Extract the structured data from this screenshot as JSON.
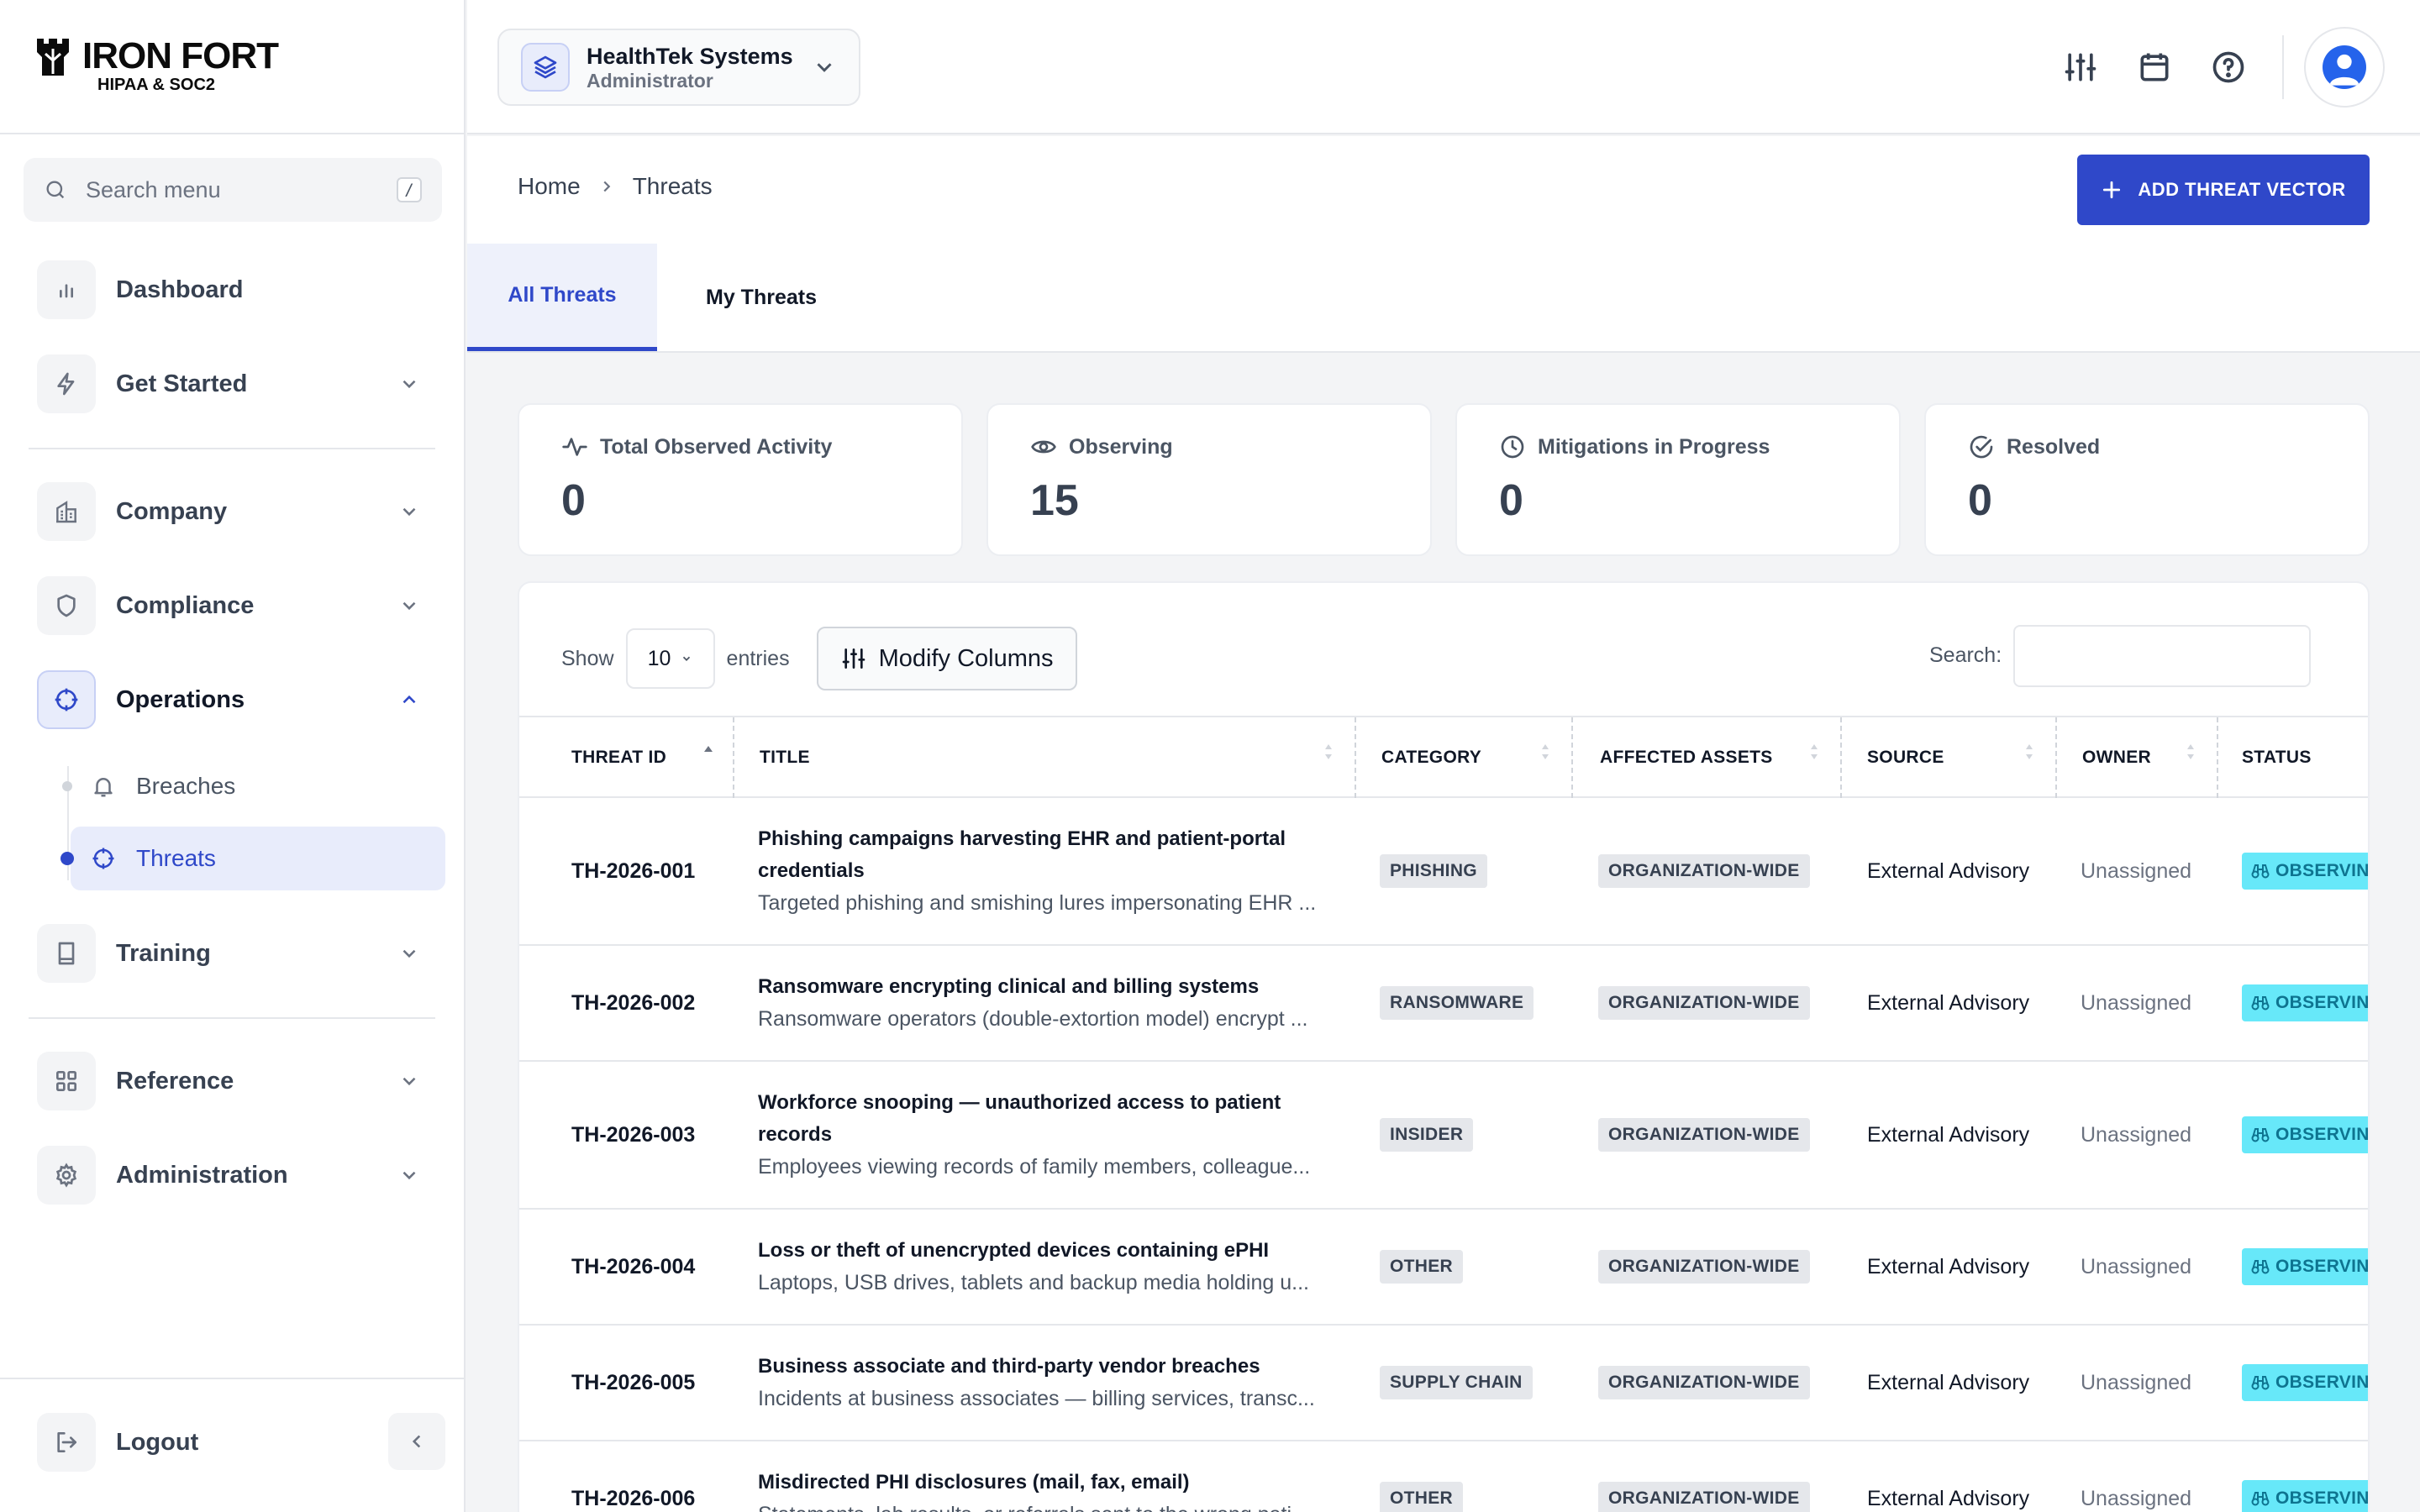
{
  "brand": {
    "name": "IRON FORT",
    "subtitle": "HIPAA & SOC2"
  },
  "sidebar": {
    "search_placeholder": "Search menu",
    "search_shortcut": "/",
    "items": [
      {
        "label": "Dashboard",
        "icon": "bar-chart-icon"
      },
      {
        "label": "Get Started",
        "icon": "bolt-icon"
      },
      {
        "label": "Company",
        "icon": "building-icon"
      },
      {
        "label": "Compliance",
        "icon": "shield-icon"
      },
      {
        "label": "Operations",
        "icon": "crosshair-icon"
      },
      {
        "label": "Training",
        "icon": "book-icon"
      },
      {
        "label": "Reference",
        "icon": "grid-icon"
      },
      {
        "label": "Administration",
        "icon": "gear-icon"
      }
    ],
    "operations_children": [
      {
        "label": "Breaches",
        "icon": "bell-icon"
      },
      {
        "label": "Threats",
        "icon": "crosshair-icon"
      }
    ],
    "logout_label": "Logout"
  },
  "header": {
    "org_name": "HealthTek Systems",
    "org_role": "Administrator"
  },
  "breadcrumb": {
    "home": "Home",
    "current": "Threats"
  },
  "actions": {
    "add_label": "ADD THREAT VECTOR"
  },
  "tabs": {
    "all": "All Threats",
    "mine": "My Threats"
  },
  "stats": [
    {
      "label": "Total Observed Activity",
      "value": "0"
    },
    {
      "label": "Observing",
      "value": "15"
    },
    {
      "label": "Mitigations in Progress",
      "value": "0"
    },
    {
      "label": "Resolved",
      "value": "0"
    }
  ],
  "table_controls": {
    "show_label": "Show",
    "entries_value": "10",
    "entries_label": "entries",
    "modify_columns_label": "Modify Columns",
    "search_label": "Search:"
  },
  "columns": [
    "THREAT ID",
    "TITLE",
    "CATEGORY",
    "AFFECTED ASSETS",
    "SOURCE",
    "OWNER",
    "STATUS"
  ],
  "rows": [
    {
      "id": "TH-2026-001",
      "title": "Phishing campaigns harvesting EHR and patient-portal credentials",
      "desc": "Targeted phishing and smishing lures impersonating EHR ...",
      "category": "PHISHING",
      "assets": "ORGANIZATION-WIDE",
      "source": "External Advisory",
      "owner": "Unassigned",
      "status": "OBSERVING"
    },
    {
      "id": "TH-2026-002",
      "title": "Ransomware encrypting clinical and billing systems",
      "desc": "Ransomware operators (double-extortion model) encrypt ...",
      "category": "RANSOMWARE",
      "assets": "ORGANIZATION-WIDE",
      "source": "External Advisory",
      "owner": "Unassigned",
      "status": "OBSERVING"
    },
    {
      "id": "TH-2026-003",
      "title": "Workforce snooping — unauthorized access to patient records",
      "desc": "Employees viewing records of family members, colleague...",
      "category": "INSIDER",
      "assets": "ORGANIZATION-WIDE",
      "source": "External Advisory",
      "owner": "Unassigned",
      "status": "OBSERVING"
    },
    {
      "id": "TH-2026-004",
      "title": "Loss or theft of unencrypted devices containing ePHI",
      "desc": "Laptops, USB drives, tablets and backup media holding u...",
      "category": "OTHER",
      "assets": "ORGANIZATION-WIDE",
      "source": "External Advisory",
      "owner": "Unassigned",
      "status": "OBSERVING"
    },
    {
      "id": "TH-2026-005",
      "title": "Business associate and third-party vendor breaches",
      "desc": "Incidents at business associates — billing services, transc...",
      "category": "SUPPLY CHAIN",
      "assets": "ORGANIZATION-WIDE",
      "source": "External Advisory",
      "owner": "Unassigned",
      "status": "OBSERVING"
    },
    {
      "id": "TH-2026-006",
      "title": "Misdirected PHI disclosures (mail, fax, email)",
      "desc": "Statements, lab results, or referrals sent to the wrong pati...",
      "category": "OTHER",
      "assets": "ORGANIZATION-WIDE",
      "source": "External Advisory",
      "owner": "Unassigned",
      "status": "OBSERVING"
    }
  ],
  "colors": {
    "accent": "#2f48c9",
    "status_observing": "#67e8f9",
    "badge_bg": "#e5e7eb"
  }
}
